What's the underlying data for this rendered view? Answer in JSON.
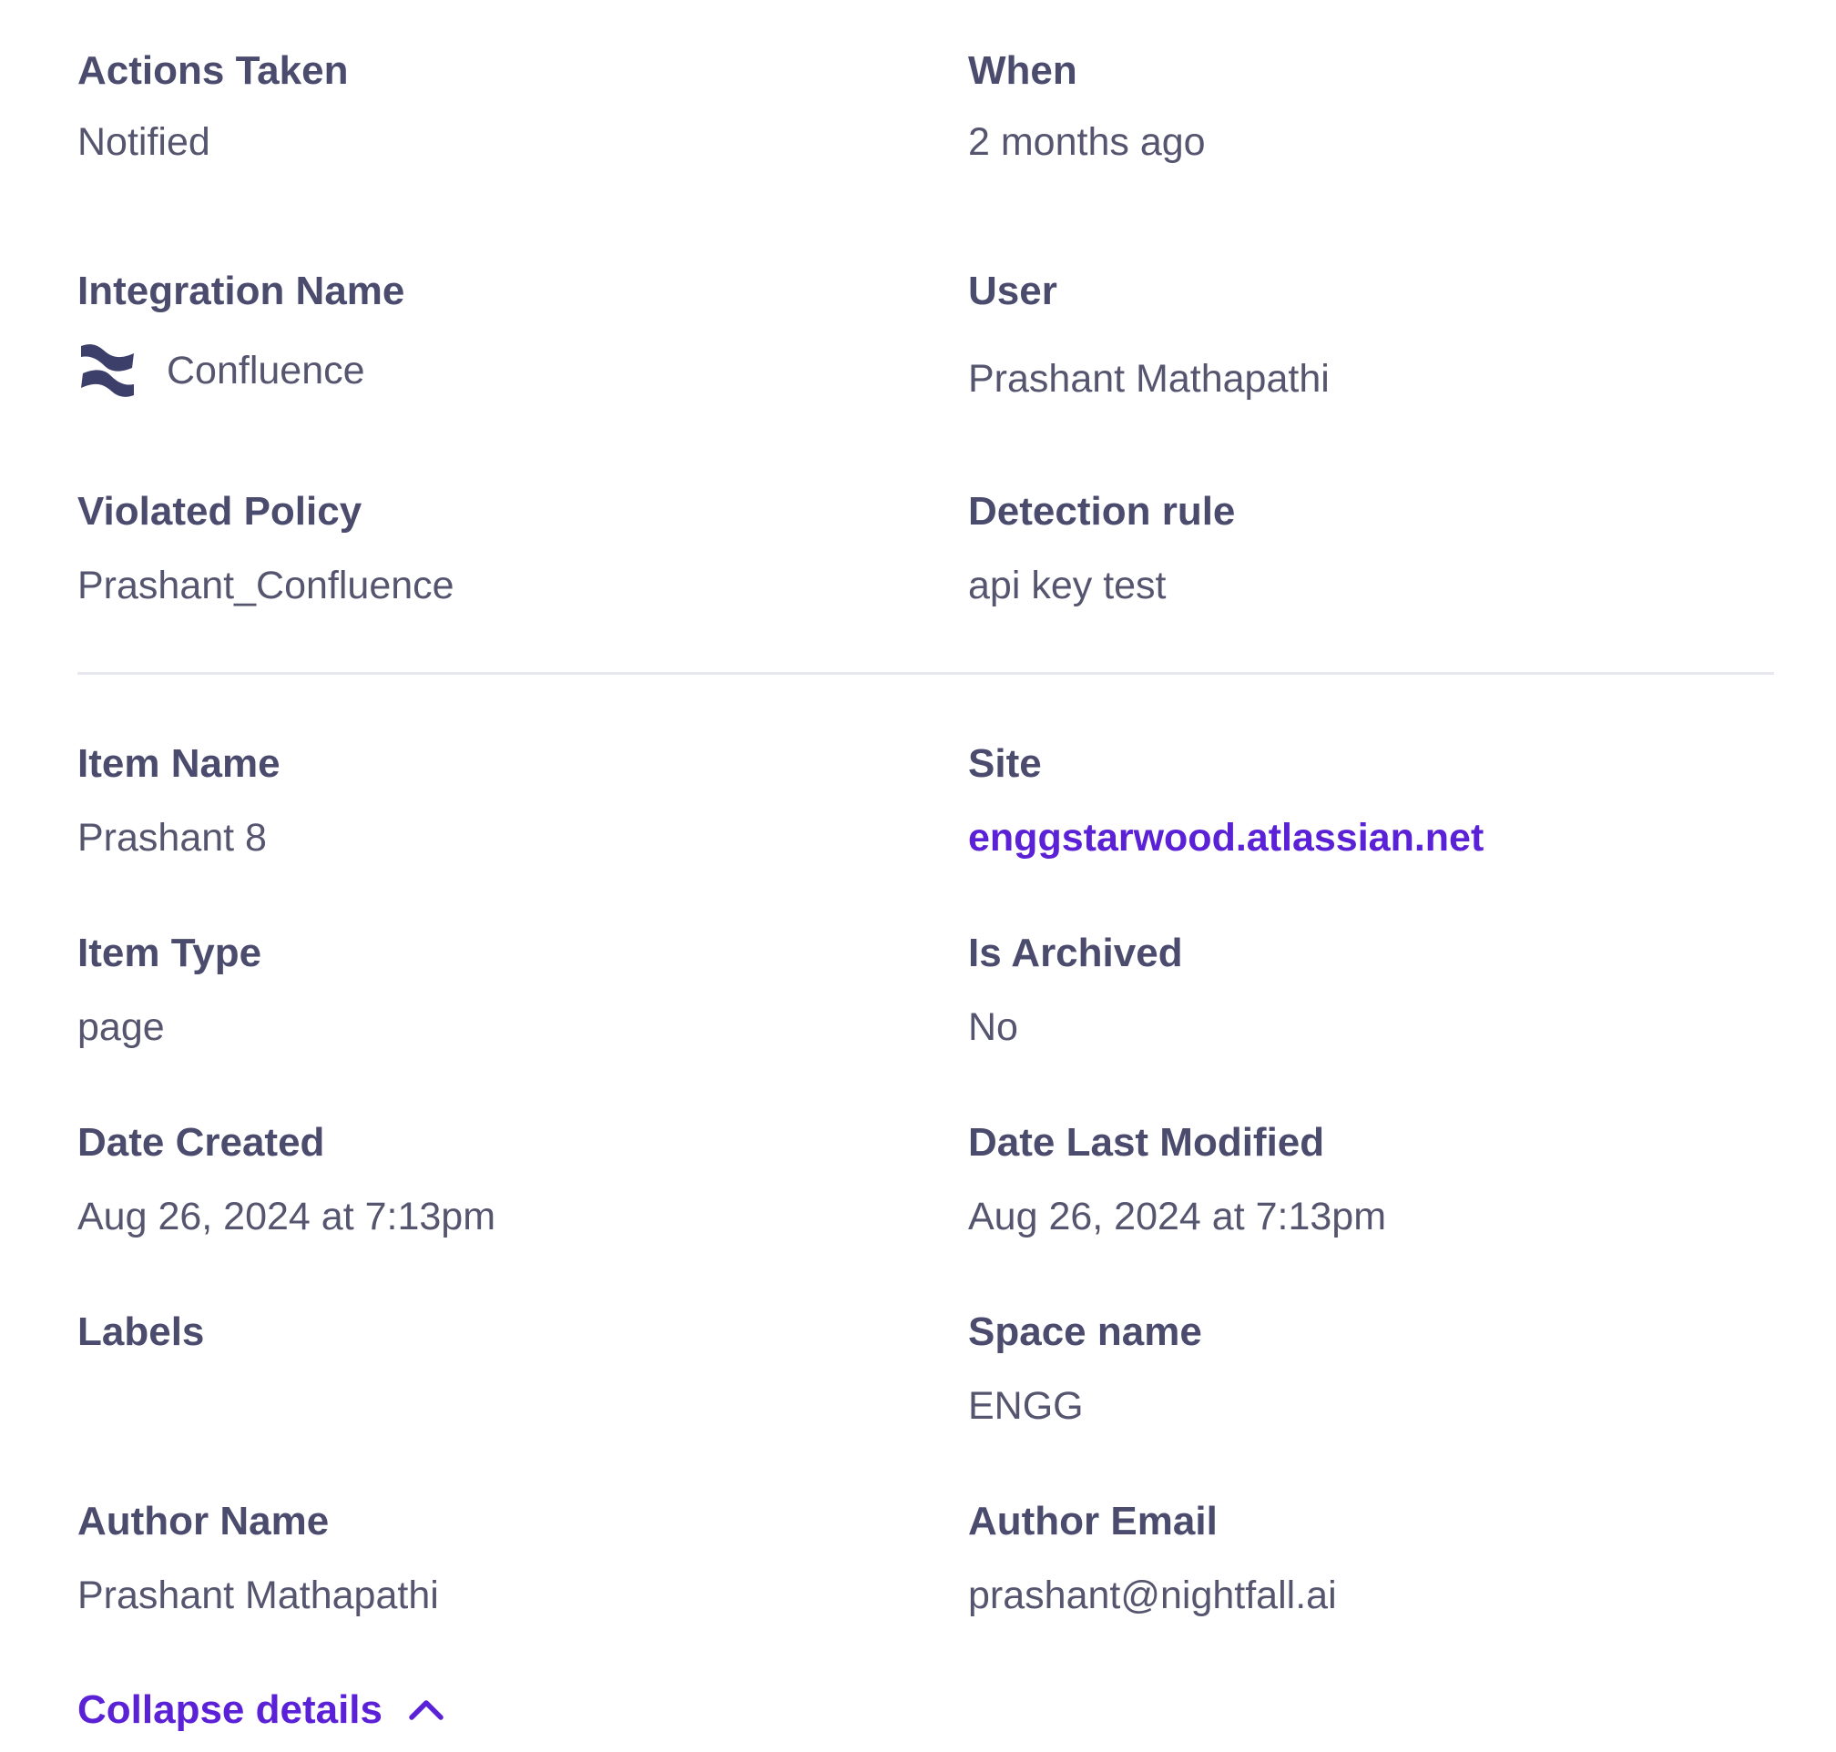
{
  "details": {
    "actions_taken": {
      "label": "Actions Taken",
      "value": "Notified"
    },
    "when": {
      "label": "When",
      "value": "2 months ago"
    },
    "integration_name": {
      "label": "Integration Name",
      "value": "Confluence",
      "icon": "confluence-logo-icon"
    },
    "user": {
      "label": "User",
      "value": "Prashant Mathapathi"
    },
    "violated_policy": {
      "label": "Violated Policy",
      "value": "Prashant_Confluence"
    },
    "detection_rule": {
      "label": "Detection rule",
      "value": "api key test"
    },
    "item_name": {
      "label": "Item Name",
      "value": "Prashant 8"
    },
    "site": {
      "label": "Site",
      "value": "enggstarwood.atlassian.net"
    },
    "item_type": {
      "label": "Item Type",
      "value": "page"
    },
    "is_archived": {
      "label": "Is Archived",
      "value": "No"
    },
    "date_created": {
      "label": "Date Created",
      "value": "Aug 26, 2024 at 7:13pm"
    },
    "date_last_modified": {
      "label": "Date Last Modified",
      "value": "Aug 26, 2024 at 7:13pm"
    },
    "labels": {
      "label": "Labels",
      "value": ""
    },
    "space_name": {
      "label": "Space name",
      "value": "ENGG"
    },
    "author_name": {
      "label": "Author Name",
      "value": "Prashant Mathapathi"
    },
    "author_email": {
      "label": "Author Email",
      "value": "prashant@nightfall.ai"
    }
  },
  "collapse": {
    "label": "Collapse details",
    "icon": "chevron-up-icon"
  },
  "colors": {
    "label": "#4b4b6e",
    "value": "#55556f",
    "link": "#5b21d6",
    "divider": "#e6e7ef",
    "icon": "#3d3f6b"
  }
}
